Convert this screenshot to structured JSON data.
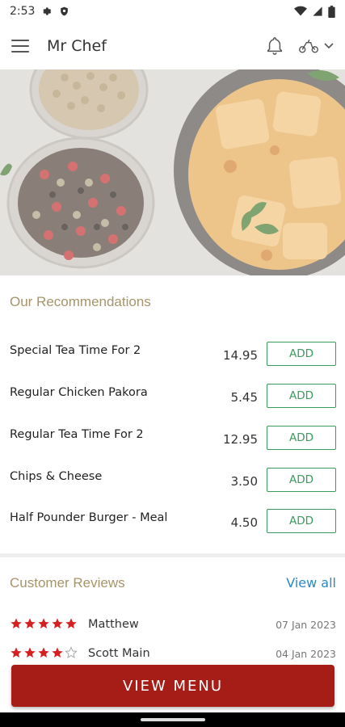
{
  "status_bar": {
    "time": "2:53"
  },
  "app_bar": {
    "title": "Mr Chef"
  },
  "recommendations": {
    "title": "Our Recommendations",
    "add_label": "ADD",
    "items": [
      {
        "name": "Special Tea Time For 2",
        "price": "14.95"
      },
      {
        "name": "Regular Chicken Pakora",
        "price": "5.45"
      },
      {
        "name": "Regular Tea Time For 2",
        "price": "12.95"
      },
      {
        "name": "Chips & Cheese",
        "price": "3.50"
      },
      {
        "name": "Half Pounder Burger - Meal",
        "price": "4.50"
      }
    ]
  },
  "reviews": {
    "title": "Customer Reviews",
    "view_all": "View all",
    "items": [
      {
        "name": "Matthew",
        "date": "07 Jan 2023",
        "rating": 5
      },
      {
        "name": "Scott Main",
        "date": "04 Jan 2023",
        "rating": 4
      }
    ]
  },
  "cta": {
    "label": "VIEW MENU"
  },
  "colors": {
    "accent_red": "#a51d16",
    "add_green": "#3a9a5c",
    "section_gold": "#a6946a",
    "link_blue": "#2a8ac4",
    "star_red": "#d42020"
  }
}
